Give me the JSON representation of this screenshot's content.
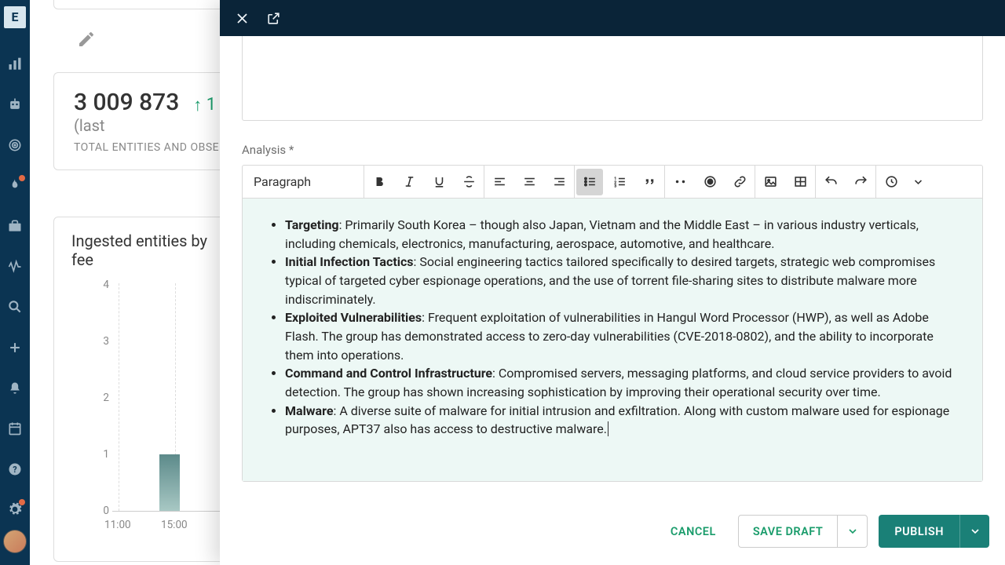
{
  "sidebar": {
    "logo": "E"
  },
  "dashboard": {
    "stat": {
      "number": "3 009 873",
      "trend": "1",
      "paren": "(last",
      "label": "TOTAL ENTITIES AND OBSER"
    },
    "chart": {
      "title": "Ingested entities by fee"
    }
  },
  "chart_data": {
    "type": "bar",
    "categories": [
      "11:00",
      "15:00"
    ],
    "values": [
      0,
      1
    ],
    "title": "Ingested entities by fee",
    "xlabel": "",
    "ylabel": "",
    "ylim": [
      0,
      4
    ],
    "yticks": [
      0,
      1,
      2,
      3,
      4
    ]
  },
  "modal": {
    "field_label": "Analysis *",
    "toolbar": {
      "para": "Paragraph"
    },
    "bullets": [
      {
        "b": "Targeting",
        "t": ": Primarily South Korea – though also Japan, Vietnam and the Middle East – in various industry verticals, including chemicals, electronics, manufacturing, aerospace, automotive, and healthcare."
      },
      {
        "b": "Initial Infection Tactics",
        "t": ": Social engineering tactics tailored specifically to desired targets, strategic web compromises typical of targeted cyber espionage operations, and the use of torrent file-sharing sites to distribute malware more indiscriminately."
      },
      {
        "b": "Exploited Vulnerabilities",
        "t": ": Frequent exploitation of vulnerabilities in Hangul Word Processor (HWP), as well as Adobe Flash. The group has demonstrated access to zero-day vulnerabilities (CVE-2018-0802), and the ability to incorporate them into operations."
      },
      {
        "b": "Command and Control Infrastructure",
        "t": ": Compromised servers, messaging platforms, and cloud service providers to avoid detection. The group has shown increasing sophistication by improving their operational security over time."
      },
      {
        "b": "Malware",
        "t": ": A diverse suite of malware for initial intrusion and exfiltration. Along with custom malware used for espionage purposes, APT37 also has access to destructive malware."
      }
    ],
    "buttons": {
      "cancel": "CANCEL",
      "save_draft": "SAVE DRAFT",
      "publish": "PUBLISH"
    }
  }
}
